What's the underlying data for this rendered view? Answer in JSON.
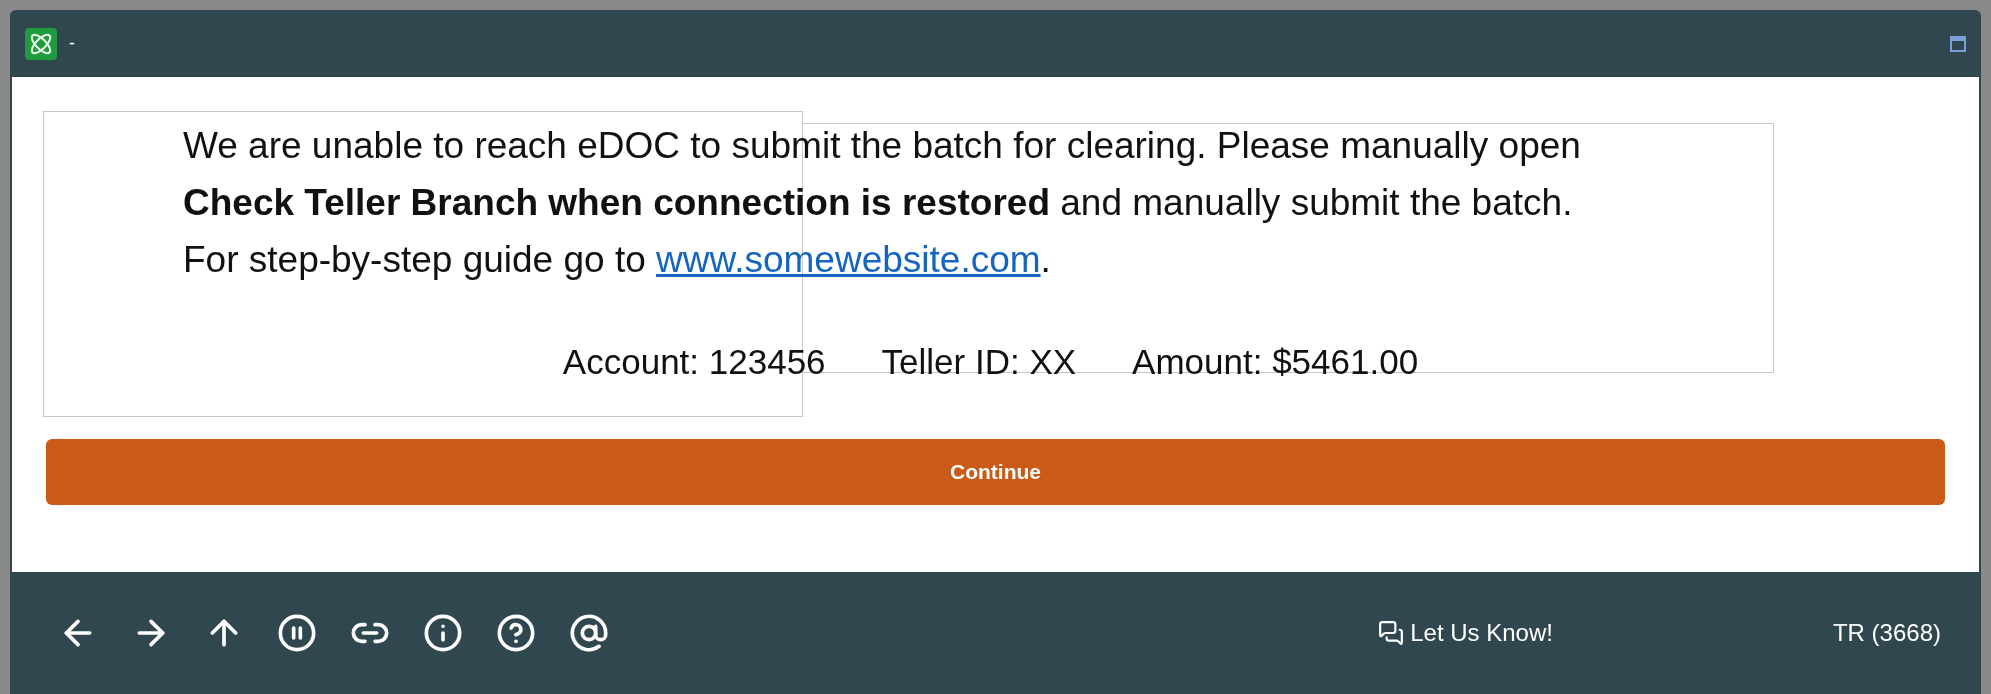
{
  "window": {
    "title": "-"
  },
  "message": {
    "text": "We are unable to reach eDOC to submit the batch for clearing. Please manually open **Check Teller Branch when connection is restored** and manually submit the batch. For step-by-step guide go to ",
    "link": "www.somewebsite.com",
    "after": "."
  },
  "details": [
    "Account: 123456",
    "Teller ID: XX",
    "Amount: $5461.00"
  ],
  "primary_button": "Continue",
  "status_bar": {
    "feedback": "Let Us Know!",
    "user": "TR (3668)"
  }
}
